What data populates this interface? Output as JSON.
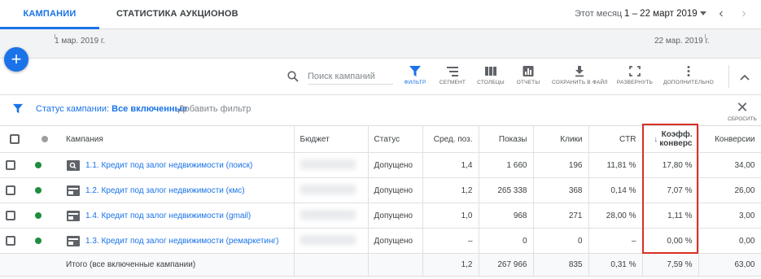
{
  "tabs": [
    {
      "label": "КАМПАНИИ",
      "active": true
    },
    {
      "label": "СТАТИСТИКА АУКЦИОНОВ",
      "active": false
    }
  ],
  "date": {
    "label": "Этот месяц",
    "range": "1 – 22 март 2019"
  },
  "timeline": {
    "start": "1 мар. 2019 г.",
    "end": "22 мар. 2019 г."
  },
  "search": {
    "placeholder": "Поиск кампаний"
  },
  "toolbar": {
    "filter": "ФИЛЬТР",
    "segment": "СЕГМЕНТ",
    "columns": "СТОЛБЦЫ",
    "reports": "ОТЧЕТЫ",
    "download": "СОХРАНИТЬ В ФАЙЛ",
    "expand": "РАЗВЕРНУТЬ",
    "more": "ДОПОЛНИТЕЛЬНО"
  },
  "filter": {
    "name": "Статус кампании:",
    "value": "Все включенные",
    "add": "Добавить фильтр",
    "reset": "СБРОСИТЬ"
  },
  "table": {
    "headers": {
      "campaign": "Кампания",
      "budget": "Бюджет",
      "status": "Статус",
      "avg_pos": "Сред. поз.",
      "impressions": "Показы",
      "clicks": "Клики",
      "ctr": "CTR",
      "conv_rate_1": "Коэфф.",
      "conv_rate_2": "конверс",
      "conversions": "Конверсии"
    },
    "rows": [
      {
        "icon": "search-campaign-icon",
        "name": "1.1. Кредит под залог недвижимости (поиск)",
        "status": "Допущено",
        "avg_pos": "1,4",
        "impressions": "1 660",
        "clicks": "196",
        "ctr": "11,81 %",
        "conv_rate": "17,80 %",
        "conversions": "34,00"
      },
      {
        "icon": "display-campaign-icon",
        "name": "1.2. Кредит под залог недвижимости (кмс)",
        "status": "Допущено",
        "avg_pos": "1,2",
        "impressions": "265 338",
        "clicks": "368",
        "ctr": "0,14 %",
        "conv_rate": "7,07 %",
        "conversions": "26,00"
      },
      {
        "icon": "display-campaign-icon",
        "name": "1.4. Кредит под залог недвижимости (gmail)",
        "status": "Допущено",
        "avg_pos": "1,0",
        "impressions": "968",
        "clicks": "271",
        "ctr": "28,00 %",
        "conv_rate": "1,11 %",
        "conversions": "3,00"
      },
      {
        "icon": "display-campaign-icon",
        "name": "1.3. Кредит под залог недвижимости (ремаркетинг)",
        "status": "Допущено",
        "avg_pos": "–",
        "impressions": "0",
        "clicks": "0",
        "ctr": "–",
        "conv_rate": "0,00 %",
        "conversions": "0,00"
      }
    ],
    "total": {
      "label": "Итого (все включенные кампании)",
      "avg_pos": "1,2",
      "impressions": "267 966",
      "clicks": "835",
      "ctr": "0,31 %",
      "conv_rate": "7,59 %",
      "conversions": "63,00"
    }
  },
  "colors": {
    "accent": "#1a73e8",
    "status_enabled": "#1e8e3e",
    "highlight": "#d93025"
  }
}
